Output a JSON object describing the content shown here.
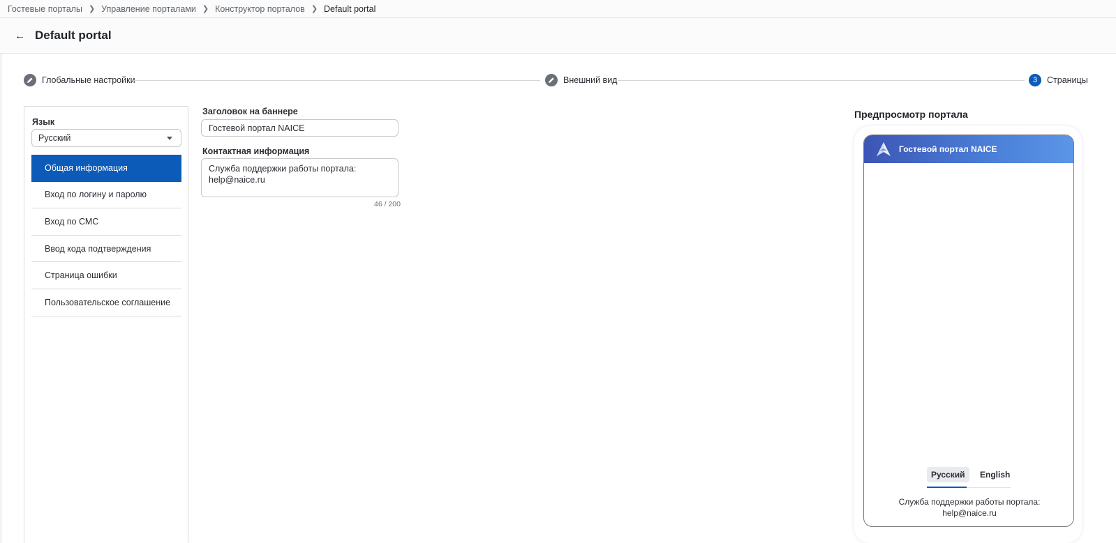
{
  "breadcrumb": {
    "items": [
      "Гостевые порталы",
      "Управление порталами",
      "Конструктор порталов",
      "Default portal"
    ]
  },
  "header": {
    "title": "Default portal"
  },
  "stepper": {
    "steps": [
      {
        "label": "Глобальные настройки",
        "marker": "pencil-icon"
      },
      {
        "label": "Внешний вид",
        "marker": "pencil-icon"
      },
      {
        "label": "Страницы",
        "number": "3"
      }
    ]
  },
  "sidebar": {
    "language_label": "Язык",
    "language_value": "Русский",
    "items": [
      {
        "label": "Общая информация"
      },
      {
        "label": "Вход по логину и паролю"
      },
      {
        "label": "Вход по СМС"
      },
      {
        "label": "Ввод кода подтверждения"
      },
      {
        "label": "Страница ошибки"
      },
      {
        "label": "Пользовательское соглашение"
      }
    ]
  },
  "form": {
    "banner_label": "Заголовок на баннере",
    "banner_value": "Гостевой портал NAICE",
    "contact_label": "Контактная информация",
    "contact_value": "Служба поддержки работы портала:\nhelp@naice.ru",
    "contact_counter": "46 / 200"
  },
  "preview": {
    "title": "Предпросмотр портала",
    "banner_title": "Гостевой портал NAICE",
    "tabs": [
      "Русский",
      "English"
    ],
    "contact_text": "Служба поддержки работы портала:\nhelp@naice.ru"
  },
  "colors": {
    "accent": "#0d5bb8",
    "banner_gradient_start": "#3d55b5",
    "banner_gradient_end": "#5b96e8"
  }
}
